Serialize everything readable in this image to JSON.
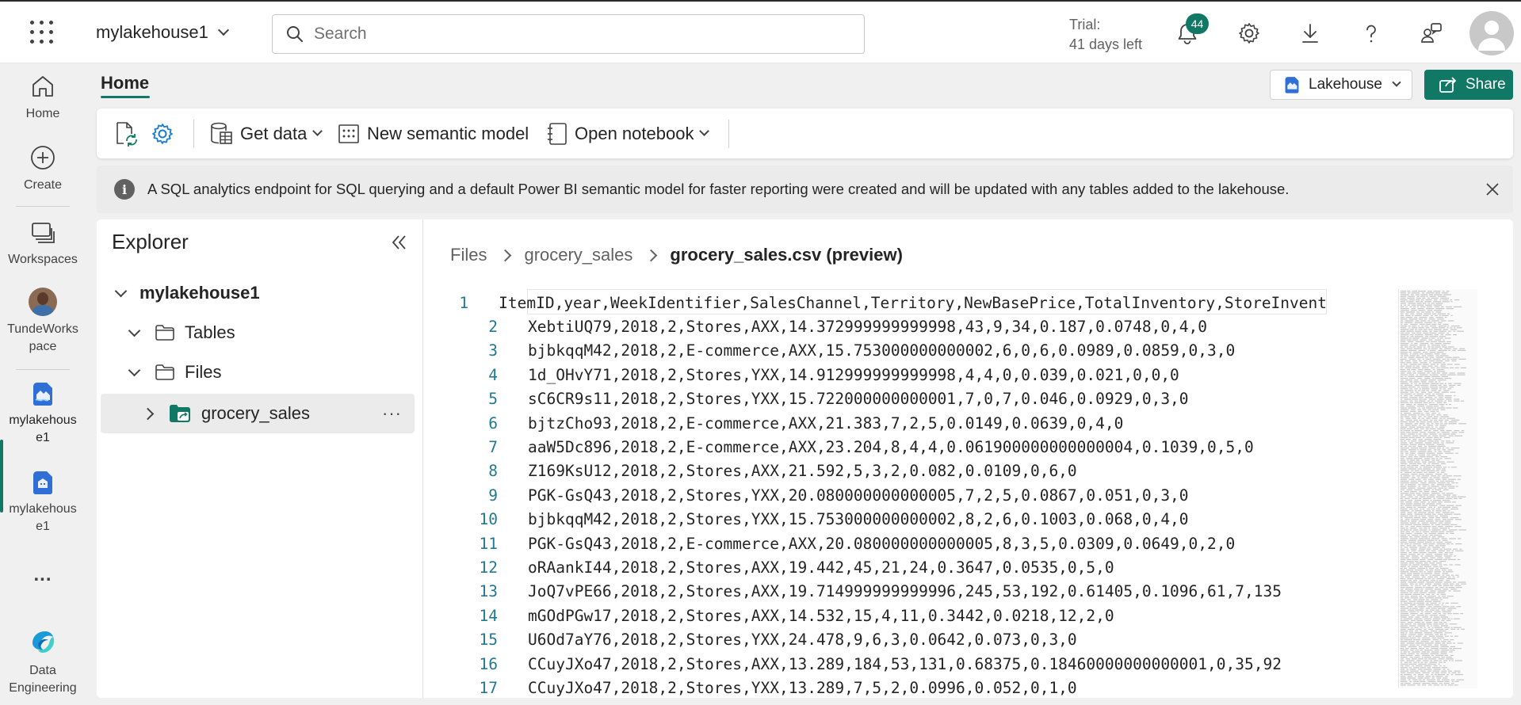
{
  "topbar": {
    "workspace_name": "mylakehouse1",
    "search_placeholder": "Search",
    "trial_line1": "Trial:",
    "trial_line2": "41 days left",
    "notification_count": "44",
    "icons": [
      "waffle-icon",
      "bell-icon",
      "gear-icon",
      "download-icon",
      "help-icon",
      "share-feedback-icon",
      "avatar"
    ]
  },
  "rail": {
    "items": [
      {
        "label": "Home",
        "icon": "home-icon"
      },
      {
        "label": "Create",
        "icon": "plus-circle-icon"
      },
      {
        "label": "Workspaces",
        "icon": "workspaces-icon"
      },
      {
        "label": "TundeWorkspace",
        "icon": "workspace-avatar"
      },
      {
        "label": "mylakehouse1",
        "icon": "lakehouse-icon",
        "active": true
      },
      {
        "label": "mylakehouse1",
        "icon": "sql-endpoint-icon"
      },
      {
        "label": "...",
        "icon": "more-icon"
      },
      {
        "label": "Data Engineering",
        "icon": "data-engineering-icon"
      }
    ],
    "tundews_line1": "TundeWorks",
    "tundews_line2": "pace",
    "lake1_line1": "mylakehous",
    "lake1_line2": "e1",
    "lake2_line1": "mylakehous",
    "lake2_line2": "e1",
    "de_line1": "Data",
    "de_line2": "Engineering"
  },
  "header": {
    "tab_home": "Home",
    "lakehouse_selector": "Lakehouse",
    "share_label": "Share"
  },
  "toolbar": {
    "get_data": "Get data",
    "new_semantic_model": "New semantic model",
    "open_notebook": "Open notebook"
  },
  "banner": {
    "text": "A SQL analytics endpoint for SQL querying and a default Power BI semantic model for faster reporting were created and will be updated with any tables added to the lakehouse."
  },
  "explorer": {
    "title": "Explorer",
    "root": "mylakehouse1",
    "tables": "Tables",
    "files": "Files",
    "folder": "grocery_sales"
  },
  "preview": {
    "breadcrumb": [
      "Files",
      "grocery_sales",
      "grocery_sales.csv (preview)"
    ],
    "lines": [
      "ItemID,year,WeekIdentifier,SalesChannel,Territory,NewBasePrice,TotalInventory,StoreInvent",
      "XebtiUQ79,2018,2,Stores,AXX,14.372999999999998,43,9,34,0.187,0.0748,0,4,0",
      "bjbkqqM42,2018,2,E-commerce,AXX,15.753000000000002,6,0,6,0.0989,0.0859,0,3,0",
      "1d_OHvY71,2018,2,Stores,YXX,14.912999999999998,4,4,0,0.039,0.021,0,0,0",
      "sC6CR9s11,2018,2,Stores,YXX,15.722000000000001,7,0,7,0.046,0.0929,0,3,0",
      "bjtzCho93,2018,2,E-commerce,AXX,21.383,7,2,5,0.0149,0.0639,0,4,0",
      "aaW5Dc896,2018,2,E-commerce,AXX,23.204,8,4,4,0.061900000000000004,0.1039,0,5,0",
      "Z169KsU12,2018,2,Stores,AXX,21.592,5,3,2,0.082,0.0109,0,6,0",
      "PGK-GsQ43,2018,2,Stores,YXX,20.080000000000005,7,2,5,0.0867,0.051,0,3,0",
      "bjbkqqM42,2018,2,Stores,YXX,15.753000000000002,8,2,6,0.1003,0.068,0,4,0",
      "PGK-GsQ43,2018,2,E-commerce,AXX,20.080000000000005,8,3,5,0.0309,0.0649,0,2,0",
      "oRAankI44,2018,2,Stores,AXX,19.442,45,21,24,0.3647,0.0535,0,5,0",
      "JoQ7vPE66,2018,2,Stores,AXX,19.714999999999996,245,53,192,0.61405,0.1096,61,7,135",
      "mGOdPGw17,2018,2,Stores,AXX,14.532,15,4,11,0.3442,0.0218,12,2,0",
      "U6Od7aY76,2018,2,Stores,YXX,24.478,9,6,3,0.0642,0.073,0,3,0",
      "CCuyJXo47,2018,2,Stores,AXX,13.289,184,53,131,0.68375,0.18460000000000001,0,35,92",
      "CCuyJXo47,2018,2,Stores,YXX,13.289,7,5,2,0.0996,0.052,0,1,0"
    ]
  },
  "colors": {
    "accent": "#117865",
    "line_number": "#237893"
  }
}
